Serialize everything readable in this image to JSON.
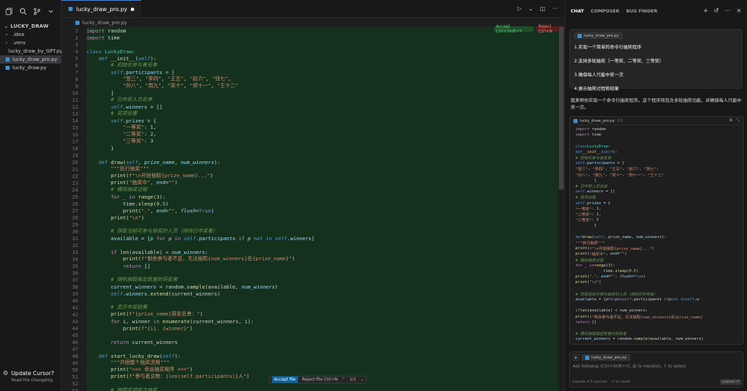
{
  "sidebar": {
    "title": "LUCKY_DRAW",
    "items": [
      {
        "label": ".idea",
        "type": "folder"
      },
      {
        "label": ".venv",
        "type": "folder"
      },
      {
        "label": "lucky_draw_by_GPT.py",
        "type": "py"
      },
      {
        "label": "lucky_draw_pro.py",
        "type": "py",
        "selected": true
      },
      {
        "label": "lucky_draw.py",
        "type": "py"
      }
    ],
    "update": {
      "title": "Update Cursor?",
      "subtitle": "Read the changelog"
    }
  },
  "editor": {
    "tab_label": "lucky_draw_pro.py",
    "breadcrumb": "lucky_draw_pro.py",
    "accept_inline": "Accept Ctrl+Shift+Y",
    "reject_inline": "Reject Ctrl+N",
    "float_bar": {
      "accept": "Accept file",
      "reject": "Reject file Ctrl+N",
      "count": "1/1"
    },
    "lines": [
      {
        "n": "1",
        "h": "<span class=\"kc\">import</span> random"
      },
      {
        "n": "2",
        "h": "<span class=\"kc\">import</span> time"
      },
      {
        "n": "3",
        "h": ""
      },
      {
        "n": "4",
        "h": "<span class=\"kw\">class</span> <span class=\"cls\">LuckyDraw</span>:"
      },
      {
        "n": "5",
        "h": "    <span class=\"kw\">def</span> <span class=\"fn\">__init__</span>(<span class=\"slf\">self</span>):"
      },
      {
        "n": "6",
        "h": "        <span class=\"cm\"># 初始化参与者名单</span>"
      },
      {
        "n": "7",
        "h": "        <span class=\"slf\">self</span>.<span class=\"var\">participants</span> = ["
      },
      {
        "n": "8",
        "h": "            <span class=\"str\">\"张三\"</span>, <span class=\"str\">\"李四\"</span>, <span class=\"str\">\"王五\"</span>, <span class=\"str\">\"赵六\"</span>, <span class=\"str\">\"钱七\"</span>,"
      },
      {
        "n": "9",
        "h": "            <span class=\"str\">\"孙八\"</span>, <span class=\"str\">\"周九\"</span>, <span class=\"str\">\"吴十\"</span>, <span class=\"str\">\"郑十一\"</span>, <span class=\"str\">\"王十二\"</span>"
      },
      {
        "n": "10",
        "h": "        ]"
      },
      {
        "n": "11",
        "h": "        <span class=\"cm\"># 已中奖人员名单</span>"
      },
      {
        "n": "12",
        "h": "        <span class=\"slf\">self</span>.<span class=\"var\">winners</span> = []"
      },
      {
        "n": "13",
        "h": "        <span class=\"cm\"># 奖项设置</span>"
      },
      {
        "n": "14",
        "h": "        <span class=\"slf\">self</span>.<span class=\"var\">prizes</span> = {"
      },
      {
        "n": "15",
        "h": "            <span class=\"str\">\"一等奖\"</span>: <span class=\"num\">1</span>,"
      },
      {
        "n": "16",
        "h": "            <span class=\"str\">\"二等奖\"</span>: <span class=\"num\">2</span>,"
      },
      {
        "n": "17",
        "h": "            <span class=\"str\">\"三等奖\"</span>: <span class=\"num\">3</span>"
      },
      {
        "n": "18",
        "h": "        }"
      },
      {
        "n": "19",
        "h": ""
      },
      {
        "n": "20",
        "h": "    <span class=\"kw\">def</span> <span class=\"fn\">draw</span>(<span class=\"slf\">self</span>, <span class=\"it\">prize_name</span>, <span class=\"it\">num_winners</span>):"
      },
      {
        "n": "21",
        "h": "        <span class=\"str\">\"\"\"执行抽奖\"\"\"</span>"
      },
      {
        "n": "22",
        "h": "        <span class=\"fn\">print</span>(<span class=\"str\">f\"\\n开始抽取{prize_name}...\"</span>)"
      },
      {
        "n": "23",
        "h": "        <span class=\"fn\">print</span>(<span class=\"str\">\"抽奖中\"</span>, <span class=\"it\">end</span>=<span class=\"str\">\"\"</span>)"
      },
      {
        "n": "24",
        "h": "        <span class=\"cm\"># 模拟抽奖过程</span>"
      },
      {
        "n": "25",
        "h": "        <span class=\"kc\">for</span> _ <span class=\"kc\">in</span> <span class=\"fn\">range</span>(<span class=\"num\">3</span>):"
      },
      {
        "n": "26",
        "h": "            time.<span class=\"fn\">sleep</span>(<span class=\"num\">0.5</span>)"
      },
      {
        "n": "27",
        "h": "            <span class=\"fn\">print</span>(<span class=\"str\">\".\"</span>, <span class=\"it\">end</span>=<span class=\"str\">\"\"</span>, <span class=\"it\">flush</span>=<span class=\"kw\">True</span>)"
      },
      {
        "n": "28",
        "h": "        <span class=\"fn\">print</span>(<span class=\"str\">\"\\n\"</span>)"
      },
      {
        "n": "29",
        "h": ""
      },
      {
        "n": "30",
        "h": "        <span class=\"cm\"># 获取当前可参与抽奖的人员（排除已中奖者）</span>"
      },
      {
        "n": "31",
        "h": "        <span class=\"var\">available</span> = [<span class=\"it\">p</span> <span class=\"kc\">for</span> <span class=\"it\">p</span> <span class=\"kc\">in</span> <span class=\"slf\">self</span>.<span class=\"var\">participants</span> <span class=\"kc\">if</span> <span class=\"it\">p</span> <span class=\"kw\">not in</span> <span class=\"slf\">self</span>.<span class=\"var\">winners</span>]"
      },
      {
        "n": "32",
        "h": ""
      },
      {
        "n": "33",
        "h": "        <span class=\"kc\">if</span> <span class=\"fn\">len</span>(available) &lt; <span class=\"it\">num_winners</span>:"
      },
      {
        "n": "34",
        "h": "            <span class=\"fn\">print</span>(<span class=\"str\">f\"剩余参与者不足，无法抽取{num_winners}名{prize_name}\"</span>)"
      },
      {
        "n": "35",
        "h": "            <span class=\"kc\">return</span> []"
      },
      {
        "n": "36",
        "h": ""
      },
      {
        "n": "37",
        "h": "        <span class=\"cm\"># 随机抽取指定数量的获奖者</span>"
      },
      {
        "n": "38",
        "h": "        <span class=\"var\">current_winners</span> = random.<span class=\"fn\">sample</span>(available, <span class=\"it\">num_winners</span>)"
      },
      {
        "n": "39",
        "h": "        <span class=\"slf\">self</span>.<span class=\"var\">winners</span>.<span class=\"fn\">extend</span>(current_winners)"
      },
      {
        "n": "40",
        "h": ""
      },
      {
        "n": "41",
        "h": "        <span class=\"cm\"># 显示中奖结果</span>"
      },
      {
        "n": "42",
        "h": "        <span class=\"fn\">print</span>(<span class=\"str\">f\"{prize_name}获奖名单：\"</span>)"
      },
      {
        "n": "43",
        "h": "        <span class=\"kc\">for</span> i, winner <span class=\"kc\">in</span> <span class=\"fn\">enumerate</span>(current_winners, <span class=\"num\">1</span>):"
      },
      {
        "n": "44",
        "h": "            <span class=\"fn\">print</span>(<span class=\"str\">f\"{i}. {winner}\"</span>)"
      },
      {
        "n": "45",
        "h": ""
      },
      {
        "n": "46",
        "h": "        <span class=\"kc\">return</span> current_winners"
      },
      {
        "n": "47",
        "h": ""
      },
      {
        "n": "48",
        "h": "    <span class=\"kw\">def</span> <span class=\"fn\">start_lucky_draw</span>(<span class=\"slf\">self</span>):"
      },
      {
        "n": "49",
        "h": "        <span class=\"str\">\"\"\"开始整个抽奖流程\"\"\"</span>"
      },
      {
        "n": "50",
        "h": "        <span class=\"fn\">print</span>(<span class=\"str\">\"=== 幸运抽奖程序 ===\"</span>)"
      },
      {
        "n": "51",
        "h": "        <span class=\"fn\">print</span>(<span class=\"str\">f\"参与者总数：{len(self.participants)}人\"</span>)"
      },
      {
        "n": "52",
        "h": ""
      },
      {
        "n": "53",
        "h": "        <span class=\"cm\"># 按照奖项依次抽奖</span>"
      }
    ]
  },
  "chat": {
    "tabs": [
      "CHAT",
      "COMPOSER",
      "BUG FINDER"
    ],
    "user_file": "lucky_draw_pro.py",
    "requirements": [
      "1.实现一个简单的命令行抽奖程序",
      "2.支持多轮抽奖（一等奖、二等奖、三等奖）",
      "3.确保每人只能中奖一次",
      "4.展示抽奖过程和结果"
    ],
    "response": "我来帮你实现一个命令行抽奖程序。这个程序将包含多轮抽奖功能，并确保每人只能中奖一次。",
    "card_file": "lucky_draw_pro.py",
    "card_count": "1/1",
    "card_lines": [
      "<span class=\"kc\">import</span> random",
      "<span class=\"kc\">import</span> time",
      "",
      "<span class=\"kw\">class</span> <span class=\"cls\">LuckyDraw</span>:",
      "    <span class=\"kw\">def</span> <span class=\"fn\">__init__</span>(<span class=\"slf\">self</span>):",
      "        <span class=\"cm\"># 初始化参与者名单</span>",
      "        <span class=\"slf\">self</span>.<span class=\"var\">participants</span> = [",
      "            <span class=\"str\">\"张三\"</span>, <span class=\"str\">\"李四\"</span>, <span class=\"str\">\"王五\"</span>, <span class=\"str\">\"赵六\"</span>, <span class=\"str\">\"钱七\"</span>,",
      "            <span class=\"str\">\"孙八\"</span>, <span class=\"str\">\"周九\"</span>, <span class=\"str\">\"吴十\"</span>, <span class=\"str\">\"郑十一\"</span>, <span class=\"str\">\"王十二\"</span>",
      "        ]",
      "        <span class=\"cm\"># 已中奖人员名单</span>",
      "        <span class=\"slf\">self</span>.<span class=\"var\">winners</span> = []",
      "        <span class=\"cm\"># 奖项设置</span>",
      "        <span class=\"slf\">self</span>.<span class=\"var\">prizes</span> = {",
      "            <span class=\"str\">\"一等奖\"</span>: <span class=\"num\">1</span>,",
      "            <span class=\"str\">\"二等奖\"</span>: <span class=\"num\">2</span>,",
      "            <span class=\"str\">\"三等奖\"</span>: <span class=\"num\">3</span>",
      "        }",
      "",
      "    <span class=\"kw\">def</span> <span class=\"fn\">draw</span>(<span class=\"slf\">self</span>, <span class=\"it\">prize_name</span>, <span class=\"it\">num_winners</span>):",
      "        <span class=\"str\">\"\"\"执行抽奖\"\"\"</span>",
      "        <span class=\"fn\">print</span>(<span class=\"str\">f\"\\n开始抽取{prize_name}...\"</span>)",
      "        <span class=\"fn\">print</span>(<span class=\"str\">\"抽奖中\"</span>, <span class=\"it\">end</span>=<span class=\"str\">\"\"</span>)",
      "        <span class=\"cm\"># 模拟抽奖过程</span>",
      "        <span class=\"kc\">for</span> _ <span class=\"kc\">in</span> <span class=\"fn\">range</span>(<span class=\"num\">3</span>):",
      "            time.<span class=\"fn\">sleep</span>(<span class=\"num\">0.5</span>)",
      "            <span class=\"fn\">print</span>(<span class=\"str\">\".\"</span>, <span class=\"it\">end</span>=<span class=\"str\">\"\"</span>, <span class=\"it\">flush</span>=<span class=\"kw\">True</span>)",
      "        <span class=\"fn\">print</span>(<span class=\"str\">\"\\n\"</span>)",
      "",
      "        <span class=\"cm\"># 获取当前可参与抽奖的人员（排除已中奖者）</span>",
      "        <span class=\"var\">available</span> = [<span class=\"it\">p</span> <span class=\"kc\">for</span> <span class=\"it\">p</span> <span class=\"kc\">in</span> <span class=\"slf\">self</span>.participants <span class=\"kc\">if</span> <span class=\"it\">p</span> <span class=\"kw\">not in</span> <span class=\"slf\">self</span>.w",
      "",
      "        <span class=\"kc\">if</span> <span class=\"fn\">len</span>(available) &lt; num_winners:",
      "            <span class=\"fn\">print</span>(<span class=\"str\">f\"剩余参与者不足，无法抽取{num_winners}名{prize_name}</span>",
      "            <span class=\"kc\">return</span> []",
      "",
      "        <span class=\"cm\"># 随机抽取指定数量的获奖者</span>",
      "        <span class=\"var\">current_winners</span> = random.<span class=\"fn\">sample</span>(available, num_winners)"
    ],
    "input_file": "lucky_draw_pro.py",
    "input_placeholder": "Ask followup (Ctrl+Shift+Y), @ to mention, ↑ to select",
    "model": "claude-3.5-sonnet",
    "shortcut": "⏎ to send",
    "send": "submit ⏎"
  }
}
